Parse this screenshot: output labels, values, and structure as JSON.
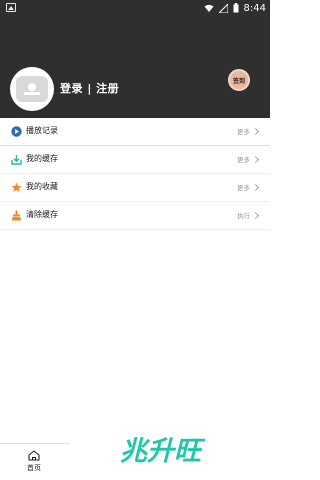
{
  "status_bar": {
    "time": "8:44"
  },
  "header": {
    "login_text": "登录 | 注册",
    "signin_label": "签到"
  },
  "menu": [
    {
      "label": "播放记录",
      "right": "更多",
      "icon": "play-icon"
    },
    {
      "label": "我的缓存",
      "right": "更多",
      "icon": "download-icon"
    },
    {
      "label": "我的收藏",
      "right": "更多",
      "icon": "star-icon"
    },
    {
      "label": "清除缓存",
      "right": "执行",
      "icon": "broom-icon"
    }
  ],
  "tabbar": {
    "home_label": "首页"
  },
  "watermark": {
    "text": "兆升旺"
  },
  "colors": {
    "header_bg": "#2f2f2f",
    "accent_blue": "#2b6cb0",
    "accent_teal": "#29b8a8",
    "accent_orange": "#f08a24",
    "watermark_green": "#1fc7a8"
  }
}
